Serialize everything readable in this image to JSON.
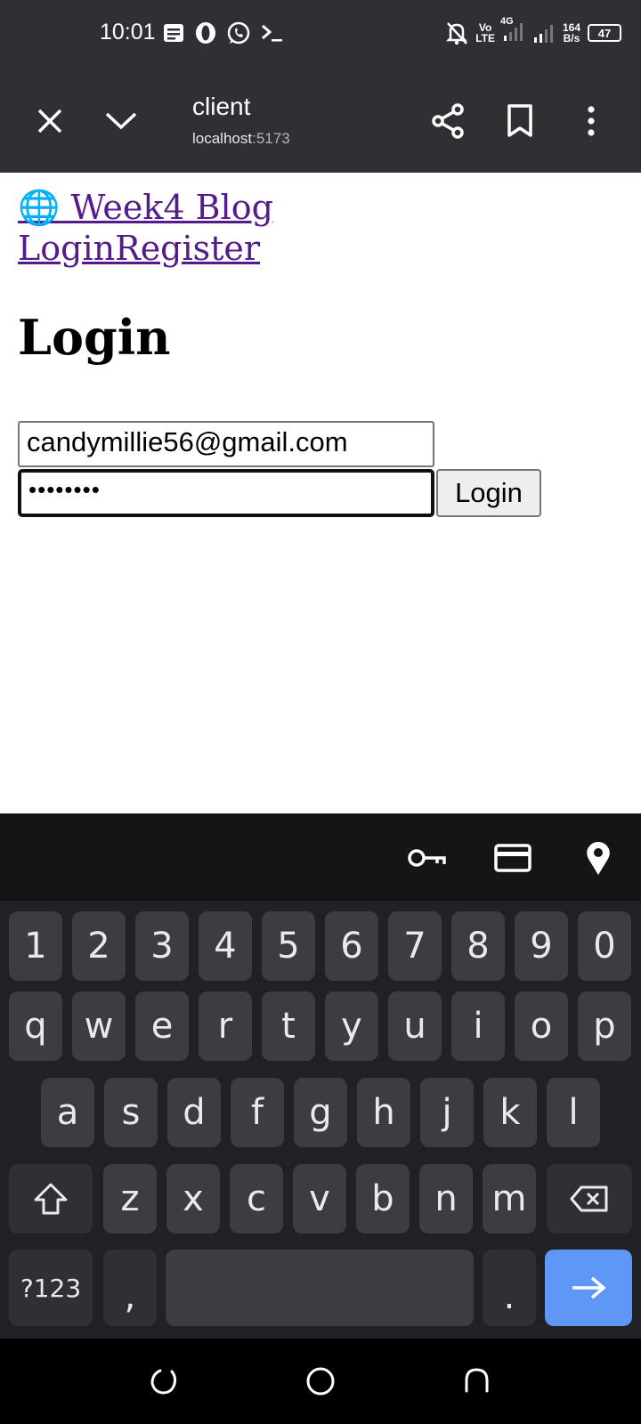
{
  "status_bar": {
    "time": "10:01",
    "network_top": "Vo",
    "network_bottom": "LTE",
    "network_gen": "4G",
    "speed_value": "164",
    "speed_unit": "B/s",
    "battery": "47"
  },
  "browser": {
    "page_title": "client",
    "url_host": "localhost",
    "url_port": ":5173"
  },
  "page": {
    "site_link": "🌐 Week4 Blog",
    "nav_login": "Login",
    "nav_register": "Register",
    "heading": "Login",
    "email_value": "candymillie56@gmail.com",
    "password_mask": "••••••••",
    "login_button": "Login"
  },
  "keyboard": {
    "number_row": [
      "1",
      "2",
      "3",
      "4",
      "5",
      "6",
      "7",
      "8",
      "9",
      "0"
    ],
    "row1": [
      "q",
      "w",
      "e",
      "r",
      "t",
      "y",
      "u",
      "i",
      "o",
      "p"
    ],
    "row2": [
      "a",
      "s",
      "d",
      "f",
      "g",
      "h",
      "j",
      "k",
      "l"
    ],
    "row3": [
      "z",
      "x",
      "c",
      "v",
      "b",
      "n",
      "m"
    ],
    "symbols_key": "?123",
    "comma_key": ",",
    "period_key": "."
  },
  "colors": {
    "bar_background": "#2f3033",
    "link": "#551a8b",
    "enter_key": "#5e97f6"
  }
}
